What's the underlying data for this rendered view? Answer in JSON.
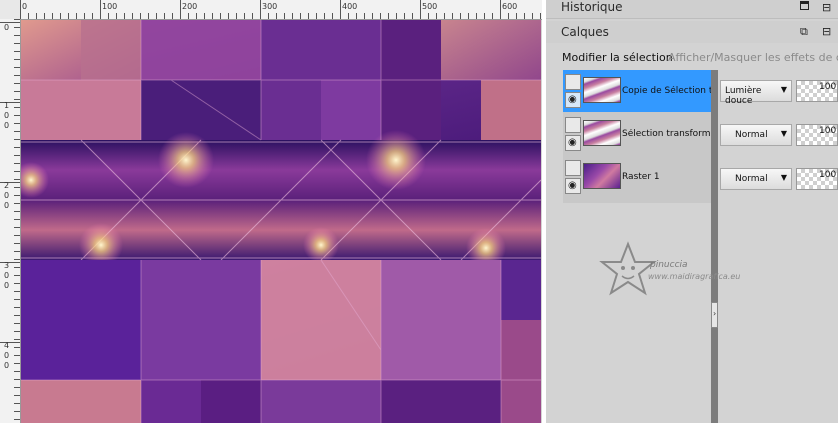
{
  "ruler": {
    "top_labels": [
      "0",
      "100",
      "200",
      "300",
      "400",
      "500",
      "600"
    ],
    "left_labels": [
      [
        "0"
      ],
      [
        "1",
        "0",
        "0"
      ],
      [
        "2",
        "0",
        "0"
      ],
      [
        "3",
        "0",
        "0"
      ],
      [
        "4",
        "0",
        "0"
      ]
    ]
  },
  "panels": {
    "history": {
      "title": "Historique"
    },
    "layers": {
      "title": "Calques",
      "toolbar": {
        "edit_selection": "Modifier la sélection",
        "toggle_mask": "Afficher/Masquer les effets de calques"
      },
      "items": [
        {
          "name": "Copie de Sélection transformée",
          "blend": "Lumière douce",
          "opacity": "100",
          "selected": true
        },
        {
          "name": "Sélection transformée",
          "blend": "Normal",
          "opacity": "100",
          "selected": false
        },
        {
          "name": "Raster 1",
          "blend": "Normal",
          "opacity": "100",
          "selected": false
        }
      ]
    }
  },
  "watermark": {
    "line1": "pinuccia",
    "line2": "www.maidiragrafica.eu"
  },
  "colors": {
    "selection": "#3399ff",
    "canvas_purple": "#6a2a8a",
    "canvas_pink": "#d0808a"
  }
}
